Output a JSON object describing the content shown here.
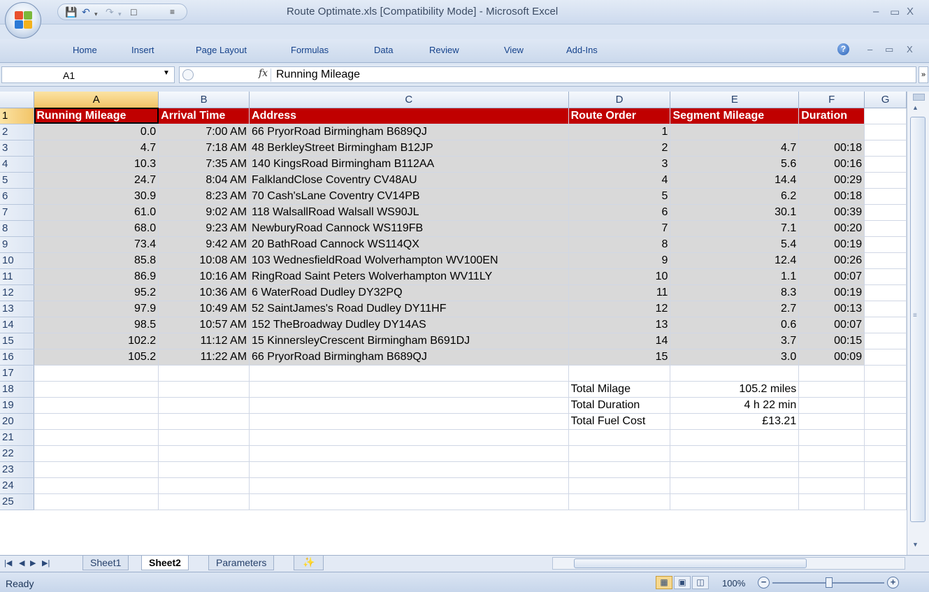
{
  "window": {
    "title": "Route Optimate.xls  [Compatibility Mode] - Microsoft Excel",
    "controls": {
      "minimize": "–",
      "restore": "▭",
      "close": "X"
    }
  },
  "ribbon": {
    "tabs": [
      "Home",
      "Insert",
      "Page Layout",
      "Formulas",
      "Data",
      "Review",
      "View",
      "Add-Ins"
    ]
  },
  "formula_bar": {
    "name_box": "A1",
    "fx_label": "fx",
    "formula": "Running Mileage"
  },
  "columns": [
    "A",
    "B",
    "C",
    "D",
    "E",
    "F",
    "G"
  ],
  "row_numbers": [
    "1",
    "2",
    "3",
    "4",
    "5",
    "6",
    "7",
    "8",
    "9",
    "10",
    "11",
    "12",
    "13",
    "14",
    "15",
    "16",
    "17",
    "18",
    "19",
    "20",
    "21",
    "22",
    "23",
    "24",
    "25"
  ],
  "header_row": {
    "running_mileage": "Running Mileage",
    "arrival_time": "Arrival Time",
    "address": "Address",
    "route_order": "Route Order",
    "segment_mileage": "Segment Mileage",
    "duration": "Duration"
  },
  "rows": [
    {
      "mileage": "0.0",
      "time": "7:00 AM",
      "address": "66 PryorRoad Birmingham B689QJ",
      "order": "1",
      "segment": "",
      "duration": ""
    },
    {
      "mileage": "4.7",
      "time": "7:18 AM",
      "address": "48 BerkleyStreet Birmingham B12JP",
      "order": "2",
      "segment": "4.7",
      "duration": "00:18"
    },
    {
      "mileage": "10.3",
      "time": "7:35 AM",
      "address": "140 KingsRoad Birmingham B112AA",
      "order": "3",
      "segment": "5.6",
      "duration": "00:16"
    },
    {
      "mileage": "24.7",
      "time": "8:04 AM",
      "address": " FalklandClose Coventry CV48AU",
      "order": "4",
      "segment": "14.4",
      "duration": "00:29"
    },
    {
      "mileage": "30.9",
      "time": "8:23 AM",
      "address": "70 Cash'sLane Coventry CV14PB",
      "order": "5",
      "segment": "6.2",
      "duration": "00:18"
    },
    {
      "mileage": "61.0",
      "time": "9:02 AM",
      "address": "118 WalsallRoad Walsall WS90JL",
      "order": "6",
      "segment": "30.1",
      "duration": "00:39"
    },
    {
      "mileage": "68.0",
      "time": "9:23 AM",
      "address": " NewburyRoad Cannock WS119FB",
      "order": "7",
      "segment": "7.1",
      "duration": "00:20"
    },
    {
      "mileage": "73.4",
      "time": "9:42 AM",
      "address": "20 BathRoad Cannock WS114QX",
      "order": "8",
      "segment": "5.4",
      "duration": "00:19"
    },
    {
      "mileage": "85.8",
      "time": "10:08 AM",
      "address": "103 WednesfieldRoad Wolverhampton WV100EN",
      "order": "9",
      "segment": "12.4",
      "duration": "00:26"
    },
    {
      "mileage": "86.9",
      "time": "10:16 AM",
      "address": " RingRoad Saint Peters Wolverhampton WV11LY",
      "order": "10",
      "segment": "1.1",
      "duration": "00:07"
    },
    {
      "mileage": "95.2",
      "time": "10:36 AM",
      "address": "6 WaterRoad Dudley DY32PQ",
      "order": "11",
      "segment": "8.3",
      "duration": "00:19"
    },
    {
      "mileage": "97.9",
      "time": "10:49 AM",
      "address": "52 SaintJames's Road Dudley DY11HF",
      "order": "12",
      "segment": "2.7",
      "duration": "00:13"
    },
    {
      "mileage": "98.5",
      "time": "10:57 AM",
      "address": "152 TheBroadway Dudley DY14AS",
      "order": "13",
      "segment": "0.6",
      "duration": "00:07"
    },
    {
      "mileage": "102.2",
      "time": "11:12 AM",
      "address": "15 KinnersleyCrescent Birmingham B691DJ",
      "order": "14",
      "segment": "3.7",
      "duration": "00:15"
    },
    {
      "mileage": "105.2",
      "time": "11:22 AM",
      "address": "66 PryorRoad Birmingham B689QJ",
      "order": "15",
      "segment": "3.0",
      "duration": "00:09"
    }
  ],
  "totals": [
    {
      "label": "Total Milage",
      "value": "105.2 miles"
    },
    {
      "label": "Total Duration",
      "value": "4 h 22 min"
    },
    {
      "label": "Total Fuel Cost",
      "value": "£13.21"
    }
  ],
  "sheet_tabs": [
    "Sheet1",
    "Sheet2",
    "Parameters"
  ],
  "active_sheet": "Sheet2",
  "status": {
    "text": "Ready",
    "zoom": "100%"
  },
  "colors": {
    "header_fill": "#c00000",
    "data_fill": "#d9d9d9",
    "selection": "#f2c467"
  }
}
